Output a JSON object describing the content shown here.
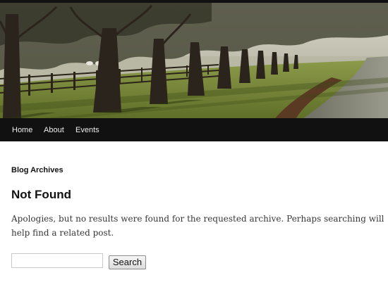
{
  "header": {
    "image_name": "tree-lined-avenue-header-image"
  },
  "nav": {
    "items": [
      {
        "label": "Home"
      },
      {
        "label": "About"
      },
      {
        "label": "Events"
      }
    ]
  },
  "main": {
    "archive_label": "Blog Archives",
    "title": "Not Found",
    "message": "Apologies, but no results were found for the requested archive. Perhaps searching will help find a related post."
  },
  "search": {
    "value": "",
    "placeholder": "",
    "button_label": "Search"
  },
  "colors": {
    "nav_background": "#111111",
    "nav_text": "#eeeeee",
    "page_background": "#ffffff",
    "heading_text": "#111111",
    "body_text": "#373737"
  }
}
